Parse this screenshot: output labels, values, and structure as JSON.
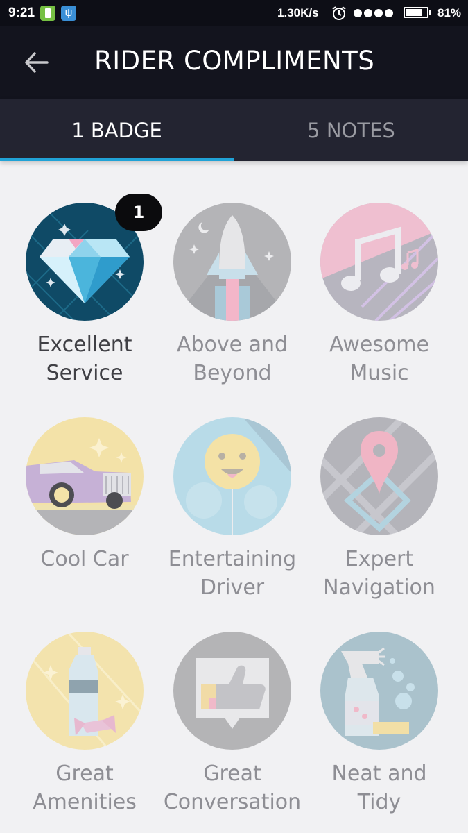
{
  "status_bar": {
    "time": "9:21",
    "network_speed": "1.30K/s",
    "battery_percent": "81%",
    "battery_level": 0.81,
    "signal_dots": 4
  },
  "header": {
    "title": "RIDER COMPLIMENTS"
  },
  "tabs": [
    {
      "label": "1 BADGE",
      "selected": true
    },
    {
      "label": "5 NOTES",
      "selected": false
    }
  ],
  "compliments": [
    {
      "label_line1": "Excellent",
      "label_line2": "Service",
      "count": "1",
      "icon": "diamond-icon",
      "earned": true
    },
    {
      "label_line1": "Above and",
      "label_line2": "Beyond",
      "icon": "rocket-icon",
      "earned": false
    },
    {
      "label_line1": "Awesome",
      "label_line2": "Music",
      "icon": "music-note-icon",
      "earned": false
    },
    {
      "label_line1": "Cool Car",
      "label_line2": "",
      "icon": "car-icon",
      "earned": false
    },
    {
      "label_line1": "Entertaining",
      "label_line2": "Driver",
      "icon": "smiley-balloon-icon",
      "earned": false
    },
    {
      "label_line1": "Expert",
      "label_line2": "Navigation",
      "icon": "map-pin-icon",
      "earned": false
    },
    {
      "label_line1": "Great",
      "label_line2": "Amenities",
      "icon": "water-bottle-icon",
      "earned": false
    },
    {
      "label_line1": "Great",
      "label_line2": "Conversation",
      "icon": "thumbs-up-icon",
      "earned": false
    },
    {
      "label_line1": "Neat and",
      "label_line2": "Tidy",
      "icon": "spray-bottle-icon",
      "earned": false
    }
  ],
  "colors": {
    "accent": "#20a2d6",
    "app_bar": "#13141e",
    "tab_bar": "#232431",
    "background": "#f1f1f3"
  }
}
